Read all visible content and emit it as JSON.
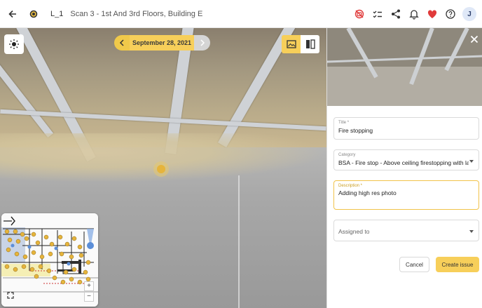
{
  "header": {
    "level": "L_1",
    "scan_title": "Scan 3 - 1st And 3rd Floors, Building E",
    "user_initial": "J"
  },
  "viewer": {
    "date": "September 28, 2021"
  },
  "issue_form": {
    "title_label": "Title *",
    "title_value": "Fire stopping",
    "category_label": "Category",
    "category_value": "BSA - Fire stop - Above ceiling firestopping with lab…",
    "description_label": "Description *",
    "description_value": "Adding high res photo",
    "assigned_placeholder": "Assigned to",
    "cancel_label": "Cancel",
    "create_label": "Create issue"
  },
  "colors": {
    "accent": "#f7cf5a",
    "favorite": "#e03a3a"
  }
}
